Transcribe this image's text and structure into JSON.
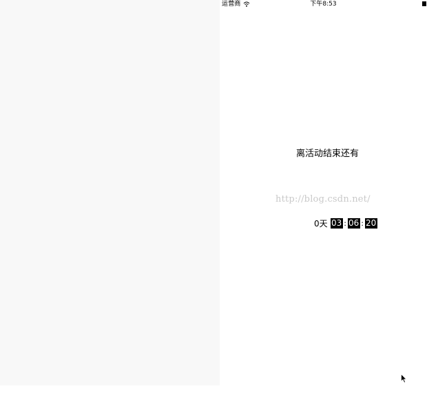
{
  "status_bar": {
    "carrier": "运营商",
    "wifi_icon": "wifi-icon",
    "time": "下午8:53",
    "battery_icon": "battery-icon"
  },
  "countdown": {
    "title": "离活动结束还有",
    "days": "0天",
    "hours": "03",
    "minutes": "06",
    "seconds": "20",
    "separator": ":"
  },
  "watermark": "http://blog.csdn.net/",
  "cursor_icon": "mouse-pointer-icon"
}
